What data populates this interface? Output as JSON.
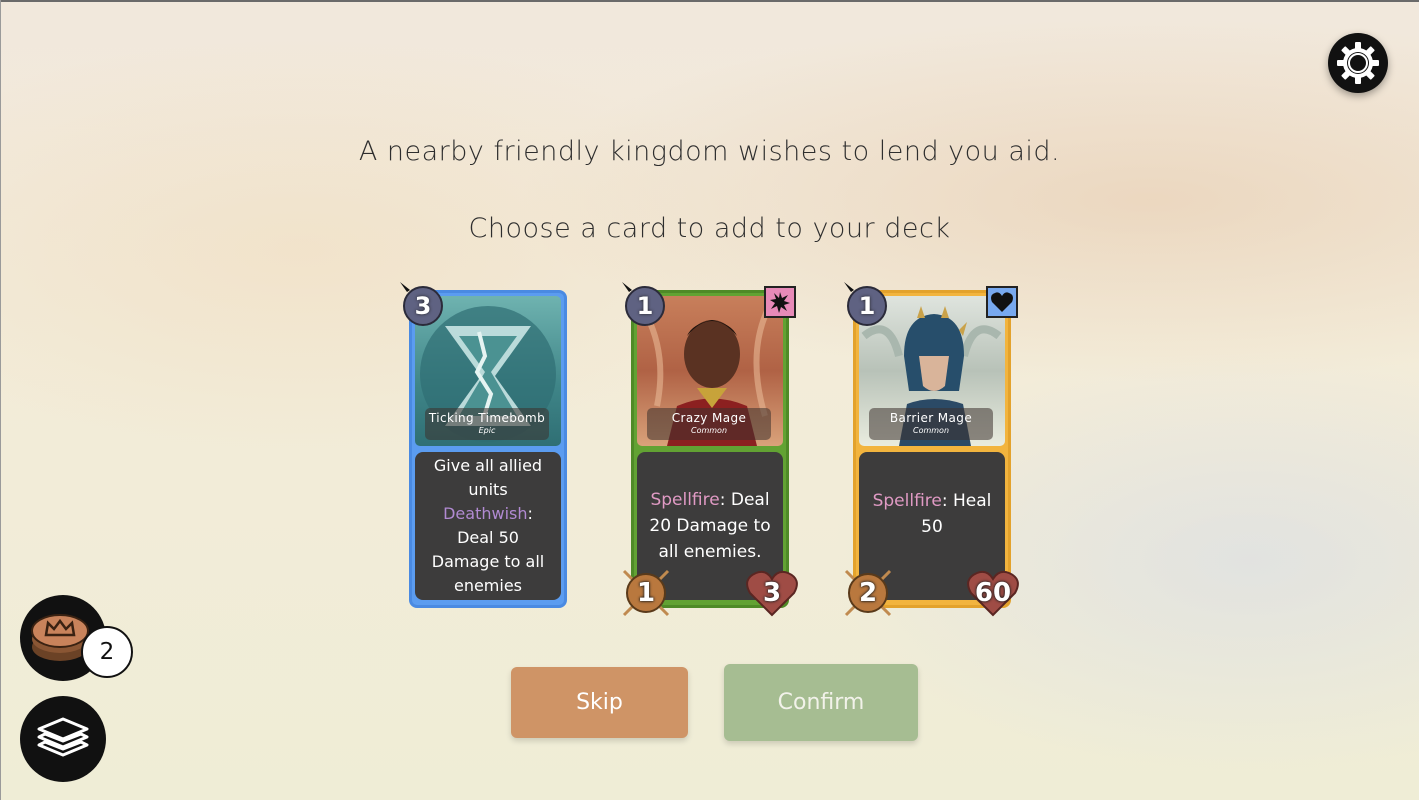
{
  "event": {
    "message": "A nearby friendly kingdom wishes to lend you aid.",
    "prompt": "Choose a card to add to your deck"
  },
  "cards": [
    {
      "name": "Ticking Timebomb",
      "rarity": "Epic",
      "cost": "3",
      "border_color": "#5b9cf0",
      "text_pre": "Give all allied units ",
      "keyword": "Deathwish",
      "text_post": ": Deal 50 Damage to all enemies"
    },
    {
      "name": "Crazy Mage",
      "rarity": "Common",
      "cost": "1",
      "border_color": "#62a233",
      "type_icon": "burst-icon",
      "keyword": "Spellfire",
      "text_post": ": Deal 20 Damage to all enemies.",
      "attack": "1",
      "health": "3"
    },
    {
      "name": "Barrier Mage",
      "rarity": "Common",
      "cost": "1",
      "border_color": "#f2b43e",
      "type_icon": "heart-icon",
      "keyword": "Spellfire",
      "text_post": ": Heal 50",
      "attack": "2",
      "health": "60"
    }
  ],
  "buttons": {
    "skip": "Skip",
    "confirm": "Confirm"
  },
  "currency": {
    "count": "2",
    "icon": "crown-coin-icon"
  },
  "deck_icon": "deck-layers-icon",
  "settings_icon": "gear-icon"
}
